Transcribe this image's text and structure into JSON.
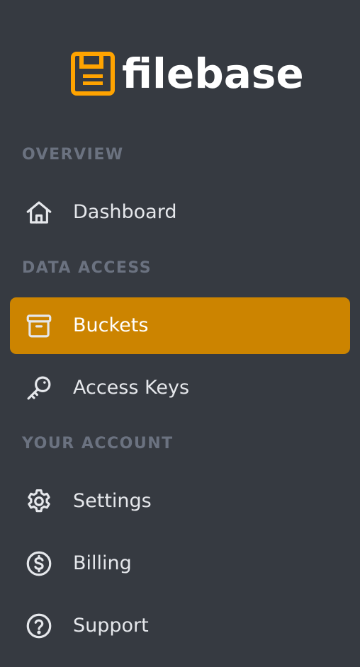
{
  "brand": {
    "name": "filebase",
    "accent": "#ffa300",
    "icon": "floppy-disk-icon"
  },
  "colors": {
    "background": "#363a41",
    "active_item": "#cc8400",
    "section_label": "#6b7280",
    "item_text": "#e5e7eb"
  },
  "sections": [
    {
      "label": "OVERVIEW",
      "items": [
        {
          "label": "Dashboard",
          "icon": "home-icon",
          "active": false
        }
      ]
    },
    {
      "label": "DATA ACCESS",
      "items": [
        {
          "label": "Buckets",
          "icon": "archive-box-icon",
          "active": true
        },
        {
          "label": "Access Keys",
          "icon": "key-icon",
          "active": false
        }
      ]
    },
    {
      "label": "YOUR ACCOUNT",
      "items": [
        {
          "label": "Settings",
          "icon": "gear-icon",
          "active": false
        },
        {
          "label": "Billing",
          "icon": "dollar-circle-icon",
          "active": false
        },
        {
          "label": "Support",
          "icon": "question-circle-icon",
          "active": false
        }
      ]
    }
  ]
}
